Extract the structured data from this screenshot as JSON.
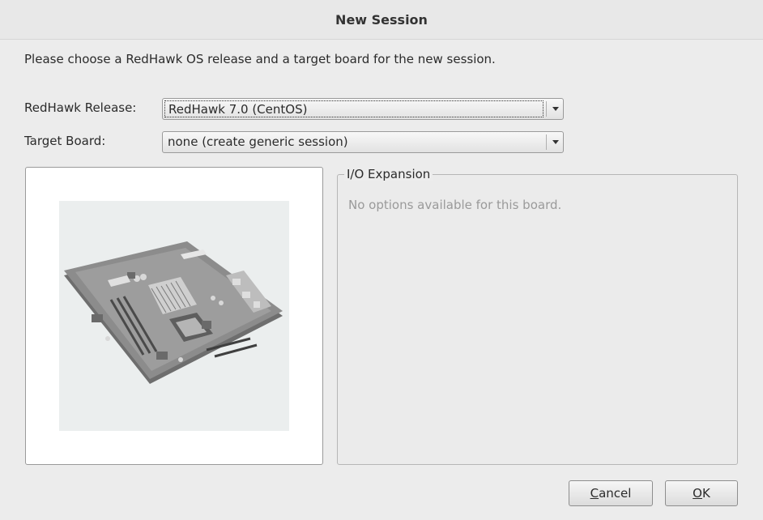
{
  "dialog": {
    "title": "New Session",
    "instructions": "Please choose a RedHawk OS release and a target board for the new session."
  },
  "release": {
    "label": "RedHawk Release:",
    "selected": "RedHawk 7.0 (CentOS)"
  },
  "board": {
    "label": "Target Board:",
    "selected": "none (create generic session)"
  },
  "board_image": {
    "description_icon": "motherboard-image"
  },
  "io_expansion": {
    "title": "I/O Expansion",
    "message": "No options available for this board."
  },
  "buttons": {
    "cancel": {
      "mnemonic": "C",
      "rest": "ancel"
    },
    "ok": {
      "mnemonic": "O",
      "rest": "K"
    }
  },
  "colors": {
    "background": "#ececec",
    "disabled_text": "#9a9a9a"
  }
}
